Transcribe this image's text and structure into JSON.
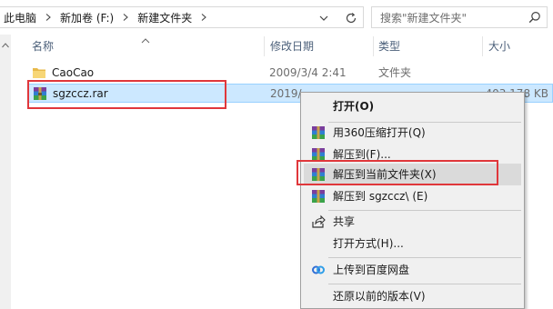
{
  "address": {
    "crumbs": [
      "此电脑",
      "新加卷 (F:)",
      "新建文件夹"
    ]
  },
  "search": {
    "placeholder": "搜索\"新建文件夹\""
  },
  "columns": {
    "name": "名称",
    "date": "修改日期",
    "type": "类型",
    "size": "大小"
  },
  "files": [
    {
      "name": "CaoCao",
      "date": "2009/3/4 2:41",
      "type": "文件夹",
      "size": "",
      "icon": "folder-icon"
    },
    {
      "name": "sgzccz.rar",
      "date": "2019/",
      "type": "",
      "size": "403,178 KB",
      "icon": "winrar-archive-icon"
    }
  ],
  "context_menu": {
    "items": [
      {
        "label": "打开(O)",
        "icon": ""
      },
      {
        "label": "用360压缩打开(Q)",
        "icon": "archive-icon"
      },
      {
        "label": "解压到(F)...",
        "icon": "archive-icon"
      },
      {
        "label": "解压到当前文件夹(X)",
        "icon": "archive-icon"
      },
      {
        "label": "解压到 sgzccz\\ (E)",
        "icon": "archive-icon"
      },
      {
        "label": "共享",
        "icon": "share-icon"
      },
      {
        "label": "打开方式(H)...",
        "icon": ""
      },
      {
        "label": "上传到百度网盘",
        "icon": "baidu-netdisk-icon"
      },
      {
        "label": "还原以前的版本(V)",
        "icon": ""
      }
    ]
  },
  "colors": {
    "selection_bg": "#cce8ff",
    "selection_border": "#99d1ff",
    "highlight_red": "#e0373b",
    "menu_bg": "#f0f0f0"
  }
}
